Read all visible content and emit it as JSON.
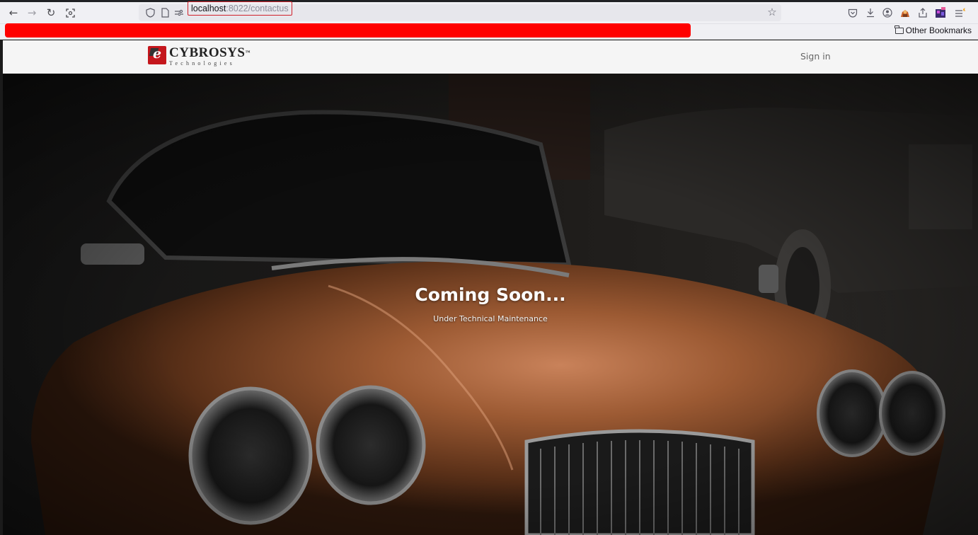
{
  "browser": {
    "url_host": "localhost",
    "url_path": ":8022/contactus",
    "bookmarks_folder_label": "Other Bookmarks"
  },
  "site": {
    "logo_name": "CYBROSYS",
    "logo_tm": "™",
    "logo_sub": "Technologies",
    "signin_label": "Sign in"
  },
  "hero": {
    "title": "Coming Soon...",
    "subtitle": "Under Technical Maintenance"
  },
  "colors": {
    "redaction_bar": "#ff0000",
    "url_highlight_border": "#d0202a",
    "header_bg": "#f5f5f5",
    "car_body": "#9c5a33"
  },
  "icons": {
    "toolbar_left": [
      "back-arrow-icon",
      "forward-arrow-icon",
      "reload-icon",
      "screenshot-icon"
    ],
    "url_left": [
      "shield-icon",
      "page-icon",
      "permissions-icon"
    ],
    "toolbar_right": [
      "pocket-icon",
      "download-icon",
      "account-icon",
      "extension-icon",
      "share-icon",
      "extension2-icon",
      "menu-icon"
    ]
  }
}
